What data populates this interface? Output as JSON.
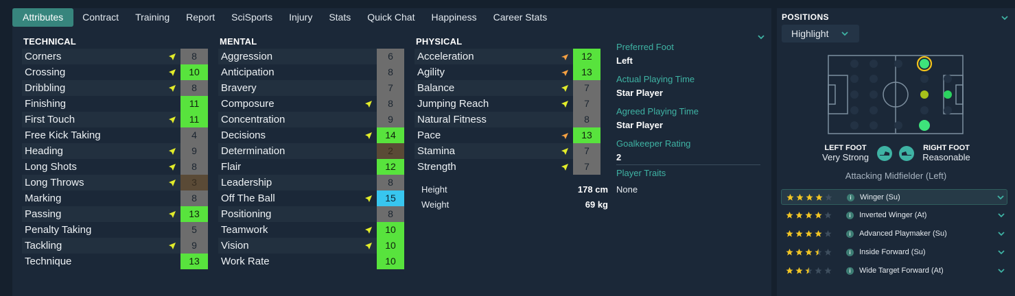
{
  "tabs": [
    "Attributes",
    "Contract",
    "Training",
    "Report",
    "SciSports",
    "Injury",
    "Stats",
    "Quick Chat",
    "Happiness",
    "Career Stats"
  ],
  "colors": {
    "green": "#58e33d",
    "grey": "#6d6d6d",
    "brown": "#5a4a36",
    "cyan": "#38c6ef",
    "arrow_up": "#f5a042",
    "arrow_yellow": "#e2ec2a",
    "accent": "#3fb3a4"
  },
  "sections": [
    {
      "title": "TECHNICAL",
      "attributes": [
        {
          "name": "Corners",
          "value": "8",
          "level": "grey",
          "arrow": "yellow"
        },
        {
          "name": "Crossing",
          "value": "10",
          "level": "green",
          "arrow": "yellow"
        },
        {
          "name": "Dribbling",
          "value": "8",
          "level": "grey",
          "arrow": "yellow"
        },
        {
          "name": "Finishing",
          "value": "11",
          "level": "green",
          "arrow": ""
        },
        {
          "name": "First Touch",
          "value": "11",
          "level": "green",
          "arrow": "yellow"
        },
        {
          "name": "Free Kick Taking",
          "value": "4",
          "level": "grey",
          "arrow": ""
        },
        {
          "name": "Heading",
          "value": "9",
          "level": "grey",
          "arrow": "yellow"
        },
        {
          "name": "Long Shots",
          "value": "8",
          "level": "grey",
          "arrow": "yellow"
        },
        {
          "name": "Long Throws",
          "value": "3",
          "level": "brown",
          "arrow": "yellow"
        },
        {
          "name": "Marking",
          "value": "8",
          "level": "grey",
          "arrow": ""
        },
        {
          "name": "Passing",
          "value": "13",
          "level": "green",
          "arrow": "yellow"
        },
        {
          "name": "Penalty Taking",
          "value": "5",
          "level": "grey",
          "arrow": ""
        },
        {
          "name": "Tackling",
          "value": "9",
          "level": "grey",
          "arrow": "yellow"
        },
        {
          "name": "Technique",
          "value": "13",
          "level": "green",
          "arrow": ""
        }
      ]
    },
    {
      "title": "MENTAL",
      "attributes": [
        {
          "name": "Aggression",
          "value": "6",
          "level": "grey",
          "arrow": ""
        },
        {
          "name": "Anticipation",
          "value": "8",
          "level": "grey",
          "arrow": ""
        },
        {
          "name": "Bravery",
          "value": "7",
          "level": "grey",
          "arrow": ""
        },
        {
          "name": "Composure",
          "value": "8",
          "level": "grey",
          "arrow": "yellow"
        },
        {
          "name": "Concentration",
          "value": "9",
          "level": "grey",
          "arrow": ""
        },
        {
          "name": "Decisions",
          "value": "14",
          "level": "green",
          "arrow": "yellow"
        },
        {
          "name": "Determination",
          "value": "2",
          "level": "brown",
          "arrow": ""
        },
        {
          "name": "Flair",
          "value": "12",
          "level": "green",
          "arrow": ""
        },
        {
          "name": "Leadership",
          "value": "8",
          "level": "grey",
          "arrow": ""
        },
        {
          "name": "Off The Ball",
          "value": "15",
          "level": "cyan",
          "arrow": "yellow"
        },
        {
          "name": "Positioning",
          "value": "8",
          "level": "grey",
          "arrow": ""
        },
        {
          "name": "Teamwork",
          "value": "10",
          "level": "green",
          "arrow": "yellow"
        },
        {
          "name": "Vision",
          "value": "10",
          "level": "green",
          "arrow": "yellow"
        },
        {
          "name": "Work Rate",
          "value": "10",
          "level": "green",
          "arrow": ""
        }
      ]
    },
    {
      "title": "PHYSICAL",
      "attributes": [
        {
          "name": "Acceleration",
          "value": "12",
          "level": "green",
          "arrow": "up"
        },
        {
          "name": "Agility",
          "value": "13",
          "level": "green",
          "arrow": "up"
        },
        {
          "name": "Balance",
          "value": "7",
          "level": "grey",
          "arrow": "yellow"
        },
        {
          "name": "Jumping Reach",
          "value": "7",
          "level": "grey",
          "arrow": "yellow"
        },
        {
          "name": "Natural Fitness",
          "value": "8",
          "level": "grey",
          "arrow": ""
        },
        {
          "name": "Pace",
          "value": "13",
          "level": "green",
          "arrow": "up"
        },
        {
          "name": "Stamina",
          "value": "7",
          "level": "grey",
          "arrow": "yellow"
        },
        {
          "name": "Strength",
          "value": "7",
          "level": "grey",
          "arrow": "yellow"
        }
      ]
    }
  ],
  "physical_info": {
    "height_label": "Height",
    "height_value": "178 cm",
    "weight_label": "Weight",
    "weight_value": "69 kg"
  },
  "details": {
    "preferred_foot_label": "Preferred Foot",
    "preferred_foot": "Left",
    "actual_playing_time_label": "Actual Playing Time",
    "actual_playing_time": "Star Player",
    "agreed_playing_time_label": "Agreed Playing Time",
    "agreed_playing_time": "Star Player",
    "gk_rating_label": "Goalkeeper Rating",
    "gk_rating": "2",
    "traits_label": "Player Traits",
    "traits": "None"
  },
  "positions": {
    "title": "POSITIONS",
    "highlight_label": "Highlight",
    "left_foot_label": "LEFT FOOT",
    "left_foot_value": "Very Strong",
    "right_foot_label": "RIGHT FOOT",
    "right_foot_value": "Reasonable",
    "role_title": "Attacking Midfielder (Left)",
    "roles": [
      {
        "name": "Winger (Su)",
        "stars": 4
      },
      {
        "name": "Inverted Winger (At)",
        "stars": 4
      },
      {
        "name": "Advanced Playmaker (Su)",
        "stars": 4
      },
      {
        "name": "Inside Forward (Su)",
        "stars": 3.5
      },
      {
        "name": "Wide Target Forward (At)",
        "stars": 2.5
      }
    ]
  }
}
